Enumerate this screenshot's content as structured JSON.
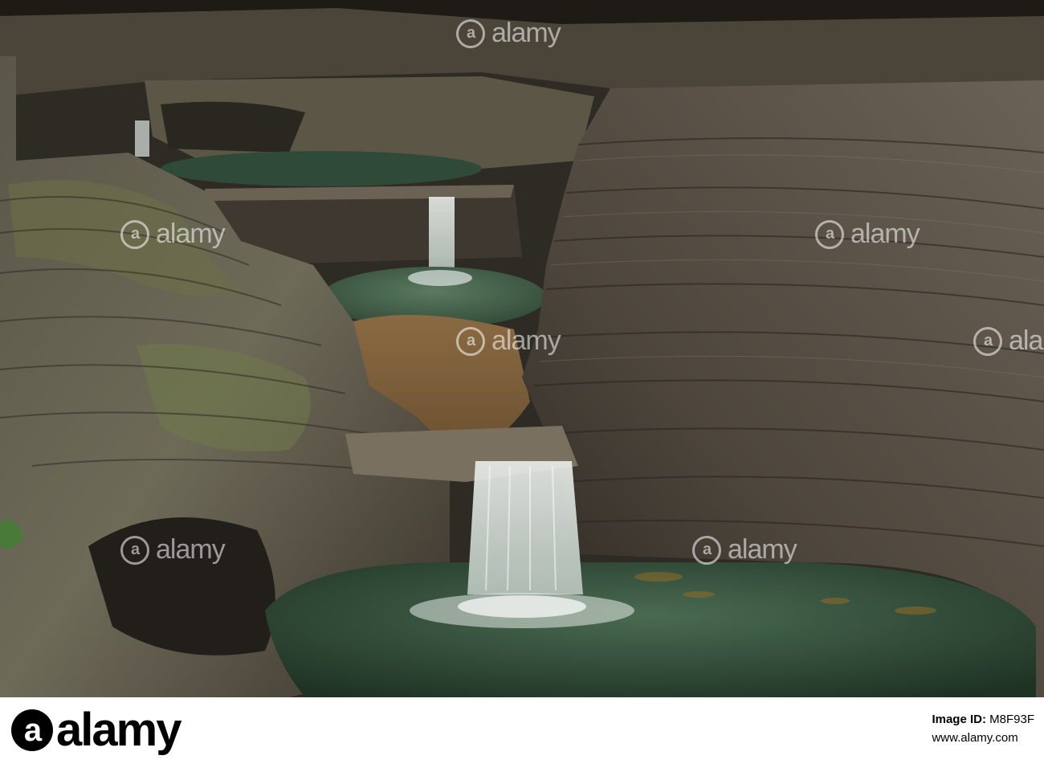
{
  "photo": {
    "subject": "Tiered waterfalls flowing through a layered shale gorge into green pools"
  },
  "watermark": {
    "text": "alamy",
    "color": "#ffffff"
  },
  "footer": {
    "logo_text": "alamy",
    "image_id_label": "Image ID:",
    "image_id": "M8F93F",
    "url": "www.alamy.com"
  }
}
